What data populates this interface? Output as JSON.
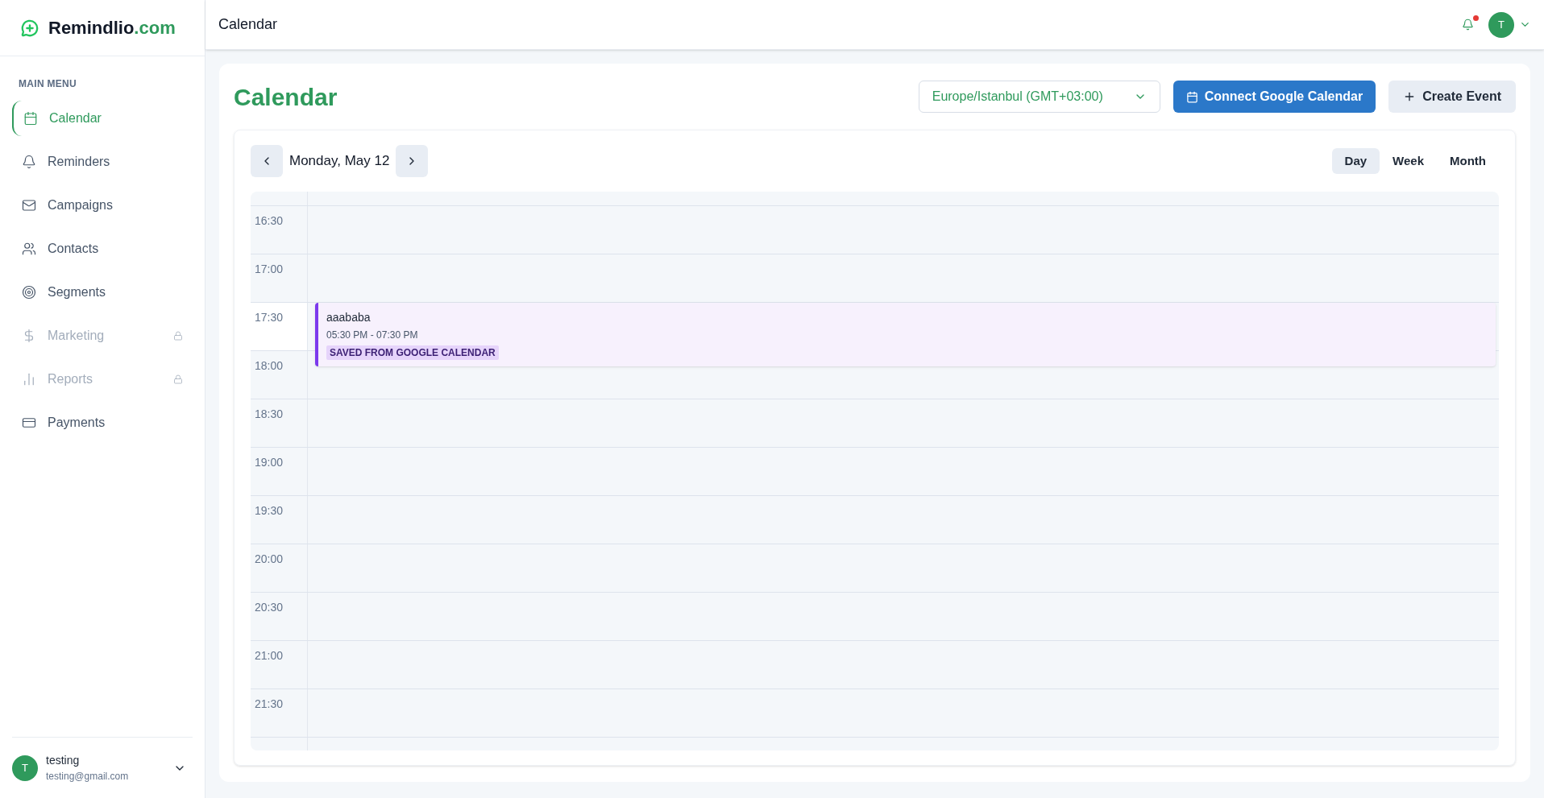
{
  "brand": {
    "name": "Remindlio",
    "suffix": ".com"
  },
  "sidebar": {
    "section": "MAIN MENU",
    "items": [
      {
        "label": "Calendar",
        "selected": true,
        "locked": false
      },
      {
        "label": "Reminders",
        "selected": false,
        "locked": false
      },
      {
        "label": "Campaigns",
        "selected": false,
        "locked": false
      },
      {
        "label": "Contacts",
        "selected": false,
        "locked": false
      },
      {
        "label": "Segments",
        "selected": false,
        "locked": false
      },
      {
        "label": "Marketing",
        "selected": false,
        "locked": true
      },
      {
        "label": "Reports",
        "selected": false,
        "locked": true
      },
      {
        "label": "Payments",
        "selected": false,
        "locked": false
      }
    ],
    "user": {
      "initial": "T",
      "name": "testing",
      "email": "testing@gmail.com"
    }
  },
  "header": {
    "title": "Calendar",
    "has_notification": true,
    "avatar": "T"
  },
  "page": {
    "title": "Calendar",
    "timezone": "Europe/Istanbul (GMT+03:00)",
    "buttons": [
      "Connect Google Calendar",
      "Create Event"
    ]
  },
  "calendar": {
    "date": "Monday, May 12",
    "views": [
      {
        "label": "Day",
        "selected": true
      },
      {
        "label": "Week",
        "selected": false
      },
      {
        "label": "Month",
        "selected": false
      }
    ],
    "slots": [
      {
        "time": "16:30"
      },
      {
        "time": "17:00"
      },
      {
        "time": "17:30",
        "events": [
          {
            "title": "aaababa",
            "time": "05:30 PM - 07:30 PM",
            "tag": "SAVED FROM GOOGLE CALENDAR",
            "color": "#7c3aed"
          }
        ]
      },
      {
        "time": "18:00"
      },
      {
        "time": "18:30"
      },
      {
        "time": "19:00"
      },
      {
        "time": "19:30"
      },
      {
        "time": "20:00"
      },
      {
        "time": "20:30"
      },
      {
        "time": "21:00"
      },
      {
        "time": "21:30"
      }
    ]
  }
}
